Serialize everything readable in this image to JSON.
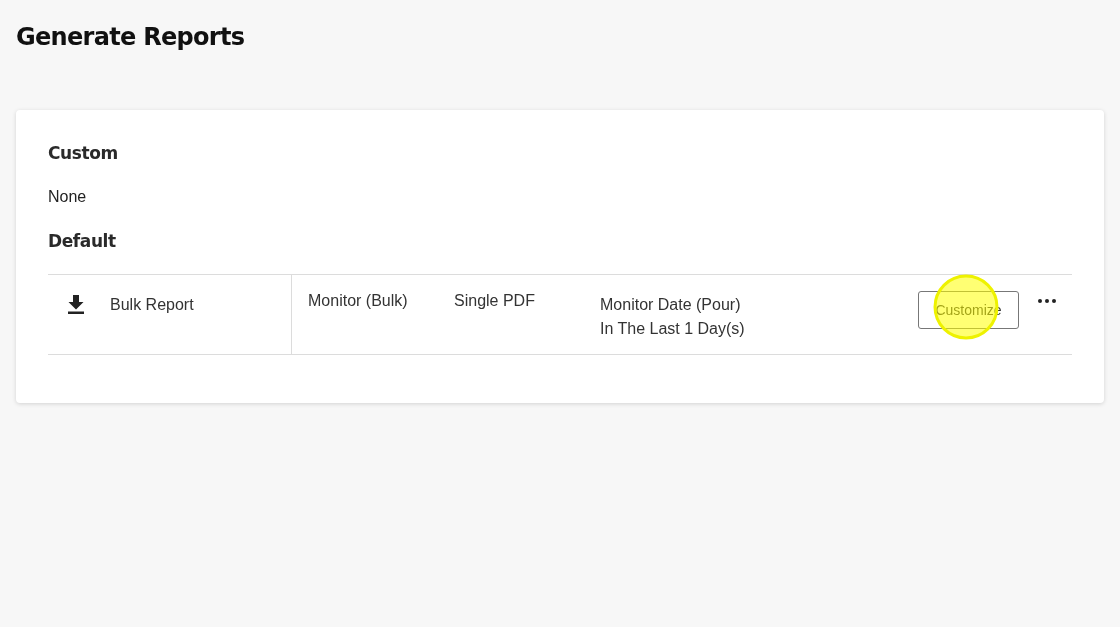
{
  "page": {
    "title": "Generate Reports"
  },
  "custom": {
    "heading": "Custom",
    "empty_text": "None"
  },
  "default": {
    "heading": "Default",
    "reports": [
      {
        "name": "Bulk Report",
        "source": "Monitor (Bulk)",
        "format": "Single PDF",
        "date_filter": {
          "field": "Monitor Date (Pour)",
          "range": "In The Last 1 Day(s)"
        },
        "action": {
          "label": "Customize",
          "highlighted": true
        }
      }
    ]
  }
}
